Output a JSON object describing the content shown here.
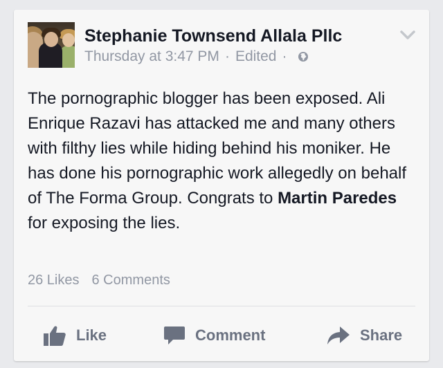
{
  "post": {
    "author": "Stephanie Townsend Allala Pllc",
    "timestamp": "Thursday at 3:47 PM",
    "separator": "·",
    "edited": "Edited",
    "privacy_icon": "globe-icon",
    "menu_icon": "chevron-down-icon",
    "text_part1": "The pornographic blogger has been exposed. Ali Enrique Razavi has attacked me and many others with filthy lies while hiding behind his moniker. He has done his pornographic work allegedly on behalf of The Forma Group. Congrats to ",
    "mention": "Martin Paredes",
    "text_part2": " for exposing the lies."
  },
  "counts": {
    "likes": "26 Likes",
    "comments": "6 Comments"
  },
  "actions": {
    "like_label": "Like",
    "like_icon": "thumbs-up-icon",
    "comment_label": "Comment",
    "comment_icon": "comment-bubble-icon",
    "share_label": "Share",
    "share_icon": "share-arrow-icon"
  },
  "colors": {
    "background": "#e9eaed",
    "card": "#f7f7f7",
    "text": "#141823",
    "muted": "#9197a3",
    "action": "#6a7180"
  }
}
